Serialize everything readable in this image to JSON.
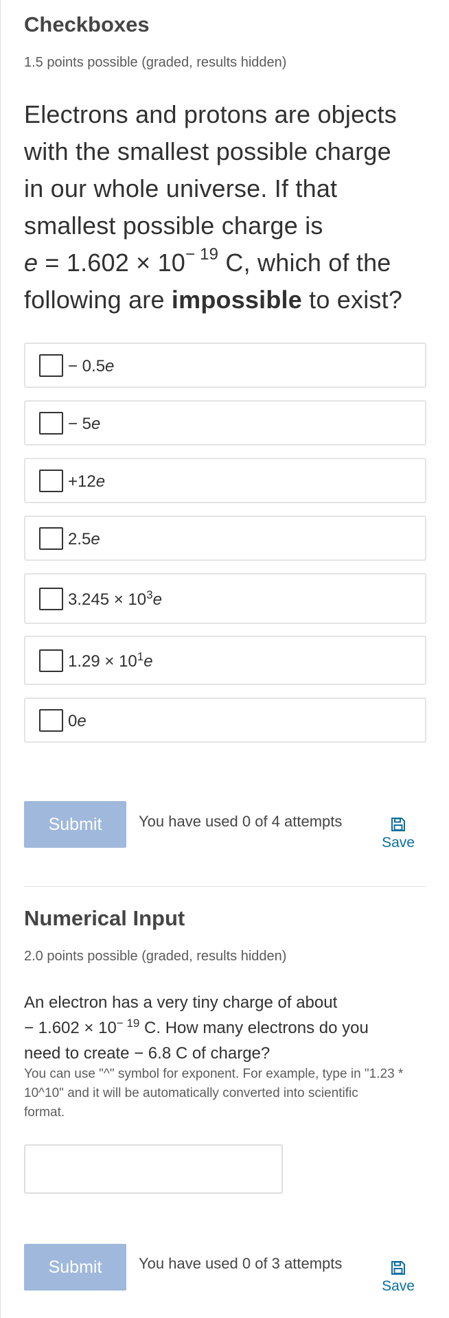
{
  "problem1": {
    "title": "Checkboxes",
    "points": "1.5 points possible (graded, results hidden)",
    "question": {
      "line1": "Electrons and protons are objects",
      "line2": "with the smallest possible charge",
      "line3": "in our whole universe. If that",
      "line4": "smallest possible charge is",
      "line5_var": "e",
      "line5_eq": " = 1.602 × 10",
      "line5_exp": "− 19",
      "line5_rest": " C, which of the",
      "line6_pre": "following are ",
      "line6_bold": "impossible",
      "line6_post": " to exist?"
    },
    "options": [
      {
        "coef": "− 0.5",
        "exp": "",
        "var": "e"
      },
      {
        "coef": "− 5",
        "exp": "",
        "var": "e"
      },
      {
        "coef": "+12",
        "exp": "",
        "var": "e"
      },
      {
        "coef": "2.5",
        "exp": "",
        "var": "e"
      },
      {
        "coef": "3.245 × 10",
        "exp": "3",
        "var": "e"
      },
      {
        "coef": "1.29 × 10",
        "exp": "1",
        "var": "e"
      },
      {
        "coef": "0",
        "exp": "",
        "var": "e"
      }
    ],
    "submit_label": "Submit",
    "attempts": "You have used 0 of 4 attempts",
    "save_label": "Save"
  },
  "problem2": {
    "title": "Numerical Input",
    "points": "2.0 points possible (graded, results hidden)",
    "question": {
      "line1": "An electron has a very tiny charge of about",
      "line2_pre": "− 1.602 × 10",
      "line2_exp": "− 19",
      "line2_post": " C. How many electrons do you",
      "line3": "need to create − 6.8 C of charge?"
    },
    "hint": {
      "line1": "You can use \"^\" symbol for exponent. For example, type in \"1.23 *",
      "line2": "10^10\" and it will be automatically converted into scientific",
      "line3": "format."
    },
    "answer_value": "",
    "submit_label": "Submit",
    "attempts": "You have used 0 of 3 attempts",
    "save_label": "Save"
  }
}
